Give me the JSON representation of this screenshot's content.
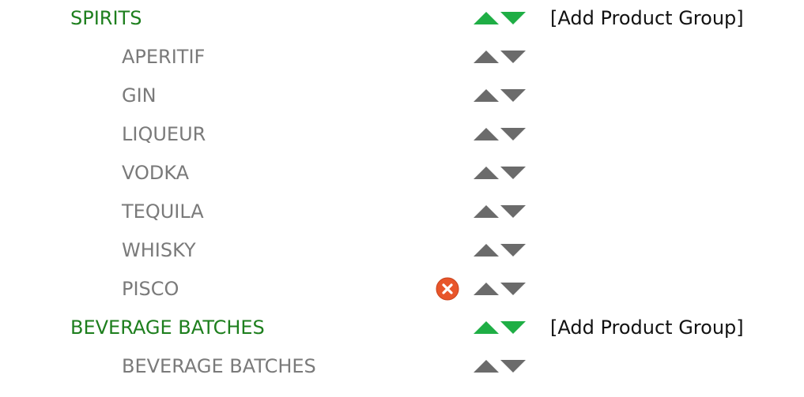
{
  "add_label": "[Add Product Group]",
  "colors": {
    "category_text": "#1e7f1e",
    "group_text": "#7a7a7a",
    "arrow_active": "#1fae45",
    "arrow_inactive": "#6b6b6b",
    "delete_fill": "#e8552a"
  },
  "icons": {
    "move_up": "triangle-up",
    "move_down": "triangle-down",
    "delete": "circle-x"
  },
  "rows": [
    {
      "type": "category",
      "label": "SPIRITS"
    },
    {
      "type": "group",
      "label": "APERITIF"
    },
    {
      "type": "group",
      "label": "GIN"
    },
    {
      "type": "group",
      "label": "LIQUEUR"
    },
    {
      "type": "group",
      "label": "VODKA"
    },
    {
      "type": "group",
      "label": "TEQUILA"
    },
    {
      "type": "group",
      "label": "WHISKY"
    },
    {
      "type": "group",
      "label": "PISCO",
      "deletable": true
    },
    {
      "type": "category",
      "label": "BEVERAGE BATCHES"
    },
    {
      "type": "group",
      "label": "BEVERAGE BATCHES"
    }
  ]
}
